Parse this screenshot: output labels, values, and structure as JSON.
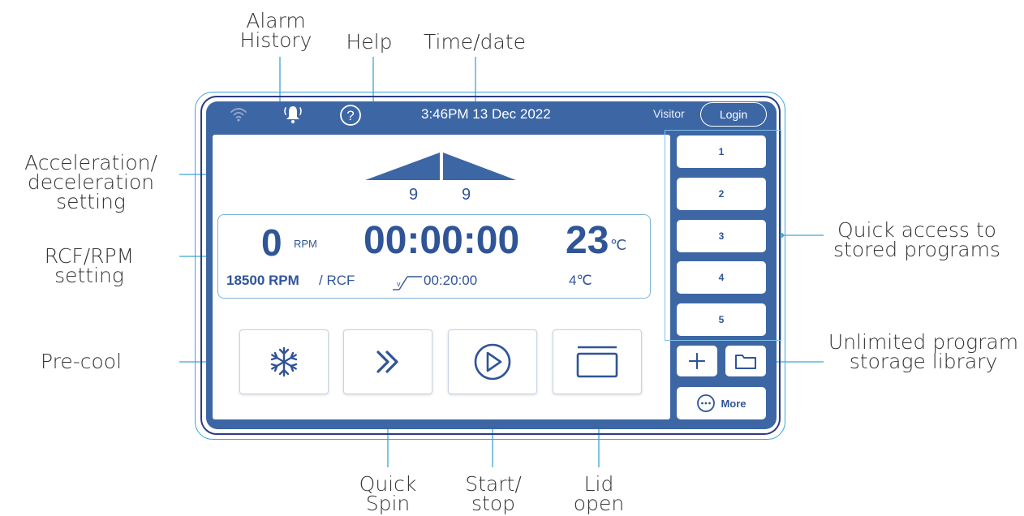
{
  "callouts": {
    "alarm_history": "Alarm\nHistory",
    "help": "Help",
    "time_date": "Time/date",
    "acceleration": "Acceleration/\ndeceleration\nsetting",
    "rcf_rpm": "RCF/RPM\nsetting",
    "precool": "Pre-cool",
    "quick_access": "Quick access to\nstored programs",
    "library": "Unlimited program\nstorage library",
    "quick_spin": "Quick\nSpin",
    "start_stop": "Start/\nstop",
    "lid_open": "Lid\nopen"
  },
  "status_bar": {
    "clock": "3:46PM 13 Dec 2022",
    "user": "Visitor",
    "login_label": "Login"
  },
  "acceleration": {
    "accel_value": "9",
    "decel_value": "9"
  },
  "readout": {
    "rpm_value": "0",
    "rpm_unit": "RPM",
    "time_value": "00:00:00",
    "temp_value": "23",
    "temp_unit": "℃",
    "rpm_setting": "18500 RPM",
    "rcf_setting": "/ RCF",
    "time_setting": "00:20:00",
    "temp_setting": "4℃"
  },
  "programs": [
    "1",
    "2",
    "3",
    "4",
    "5"
  ],
  "more_label": "More",
  "icons": {
    "wifi": "wifi-icon",
    "alarm": "alarm-bell-icon",
    "help": "help-icon",
    "precool": "snowflake-icon",
    "quick_spin": "double-chevron-icon",
    "start_stop": "play-icon",
    "lid": "lid-icon",
    "add": "plus-icon",
    "folder": "folder-icon",
    "more": "more-icon"
  },
  "colors": {
    "screen": "#3d66a5",
    "text_blue": "#2f5597",
    "callout_line": "#3aa6d6",
    "frame": "#2b3c86"
  }
}
